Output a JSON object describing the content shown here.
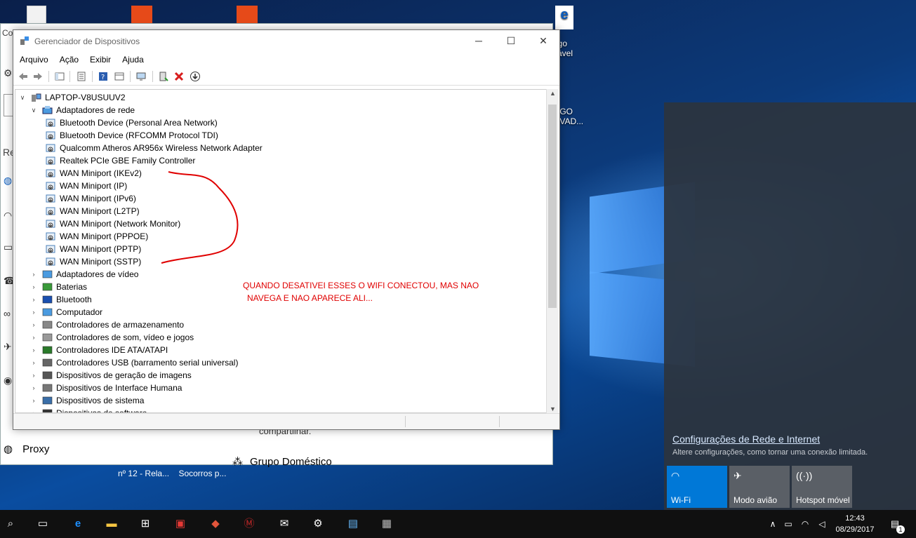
{
  "desktop": {
    "icons": [
      {
        "label": ""
      },
      {
        "label": ""
      },
      {
        "label": ""
      },
      {
        "label": "ogo\nitável"
      },
      {
        "label": "OGO\nOVAD..."
      }
    ],
    "cut_texts": [
      "nº 12 - Rela...",
      "Socorros p..."
    ]
  },
  "settings": {
    "side_prefix": "Co",
    "side_label_re": "Re",
    "proxy_label": "Proxy",
    "grupo_label": "Grupo Doméstico",
    "compart_text": "compartilhar."
  },
  "devmgr": {
    "title": "Gerenciador de Dispositivos",
    "menu": [
      "Arquivo",
      "Ação",
      "Exibir",
      "Ajuda"
    ],
    "root": "LAPTOP-V8USUUV2",
    "group_open": "Adaptadores de rede",
    "adapters": [
      "Bluetooth Device (Personal Area Network)",
      "Bluetooth Device (RFCOMM Protocol TDI)",
      "Qualcomm Atheros AR956x Wireless Network Adapter",
      "Realtek PCIe GBE Family Controller",
      "WAN Miniport (IKEv2)",
      "WAN Miniport (IP)",
      "WAN Miniport (IPv6)",
      "WAN Miniport (L2TP)",
      "WAN Miniport (Network Monitor)",
      "WAN Miniport (PPPOE)",
      "WAN Miniport (PPTP)",
      "WAN Miniport (SSTP)"
    ],
    "categories": [
      "Adaptadores de vídeo",
      "Baterias",
      "Bluetooth",
      "Computador",
      "Controladores de armazenamento",
      "Controladores de som, vídeo e jogos",
      "Controladores IDE ATA/ATAPI",
      "Controladores USB (barramento serial universal)",
      "Dispositivos de geração de imagens",
      "Dispositivos de Interface Humana",
      "Dispositivos de sistema",
      "Dispositivos de software"
    ],
    "annotation_line1": "QUANDO DESATIVEI ESSES O WIFI CONECTOU, MAS NAO",
    "annotation_line2": "NAVEGA E NAO APARECE ALI..."
  },
  "flyout": {
    "link": "Configurações de Rede e Internet",
    "subtitle": "Altere configurações, como tornar uma conexão limitada.",
    "tiles": [
      {
        "label": "Wi-Fi",
        "active": true
      },
      {
        "label": "Modo avião",
        "active": false
      },
      {
        "label": "Hotspot móvel",
        "active": false
      }
    ]
  },
  "taskbar": {
    "time": "12:43",
    "date": "08/29/2017",
    "notification_count": "1"
  },
  "colors": {
    "accent": "#0078d7",
    "annotation": "#e00000",
    "flyout_bg": "#2d343e"
  }
}
